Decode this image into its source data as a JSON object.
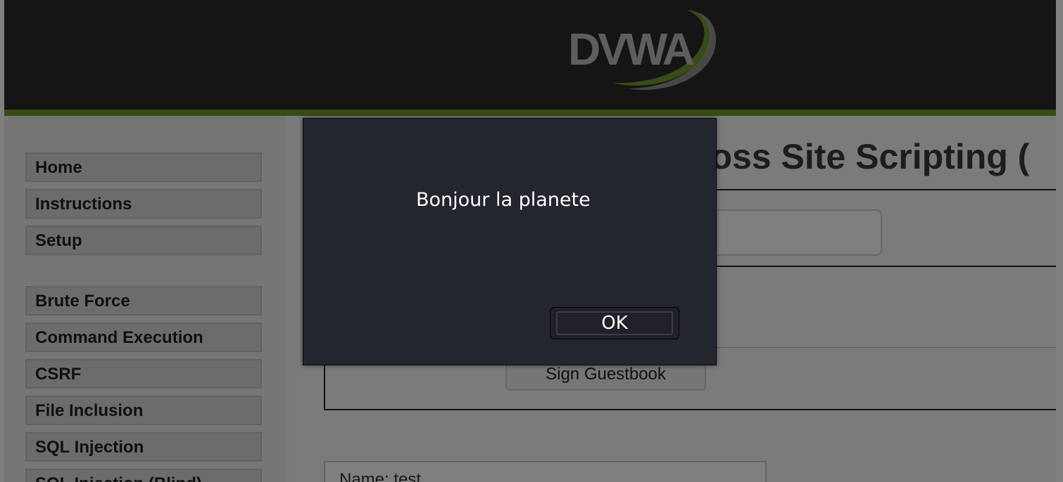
{
  "header": {
    "logo_text": "DVWA",
    "accent_color": "#6e9a2a"
  },
  "sidebar": {
    "items": [
      {
        "label": "Home"
      },
      {
        "label": "Instructions"
      },
      {
        "label": "Setup"
      },
      {
        "label": "Brute Force"
      },
      {
        "label": "Command Execution"
      },
      {
        "label": "CSRF"
      },
      {
        "label": "File Inclusion"
      },
      {
        "label": "SQL Injection"
      },
      {
        "label": "SQL Injection (Blind)"
      }
    ]
  },
  "main": {
    "title": "ross Site Scripting (",
    "sign_button_label": "Sign Guestbook",
    "entry_name": "Name: test"
  },
  "dialog": {
    "message": "Bonjour la planete",
    "ok_label": "OK"
  }
}
